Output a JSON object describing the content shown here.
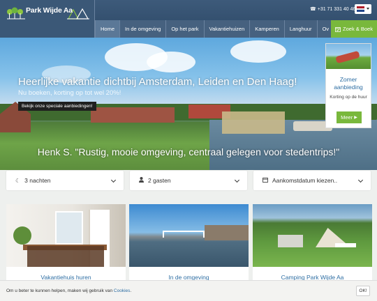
{
  "header": {
    "logo_text": "Park Wijde Aa",
    "phone": "+31 71 331 40 46",
    "phone_icon": "phone-icon",
    "language": "nl"
  },
  "nav": {
    "items": [
      "Home",
      "In de omgeving",
      "Op het park",
      "Vakantiehuizen",
      "Kamperen",
      "Langhuur",
      "Ov"
    ],
    "active": "Home",
    "cta_label": "Zoek & Boek",
    "cta_icon": "calendar-check-icon"
  },
  "hero": {
    "title": "Heerlijke vakantie dichtbij Amsterdam, Leiden en Den Haag!",
    "subtitle": "Nu boeken, korting op tot wel 20%!",
    "offer_badge": "Bekijk onze speciale aanbiedingen!",
    "quote": "Henk S. \"Rustig, mooie omgeving, centraal gelegen voor stedentrips!\""
  },
  "promo": {
    "title": "Zomer aanbieding",
    "text": "Korting op de huur",
    "button": "Meer"
  },
  "booking": {
    "nights": "3 nachten",
    "guests": "2 gasten",
    "arrival_placeholder": "Aankomstdatum kiezen.."
  },
  "cards": [
    {
      "label": "Vakantiehuis huren"
    },
    {
      "label": "In de omgeving"
    },
    {
      "label": "Camping Park Wijde Aa"
    }
  ],
  "cookie": {
    "text": "Om u beter te kunnen helpen, maken wij gebruik van ",
    "link": "Cookies",
    "ok": "OK!"
  },
  "colors": {
    "header_blue": "#3b5877",
    "accent_green": "#79b83c",
    "link_blue": "#2e6ea3"
  }
}
